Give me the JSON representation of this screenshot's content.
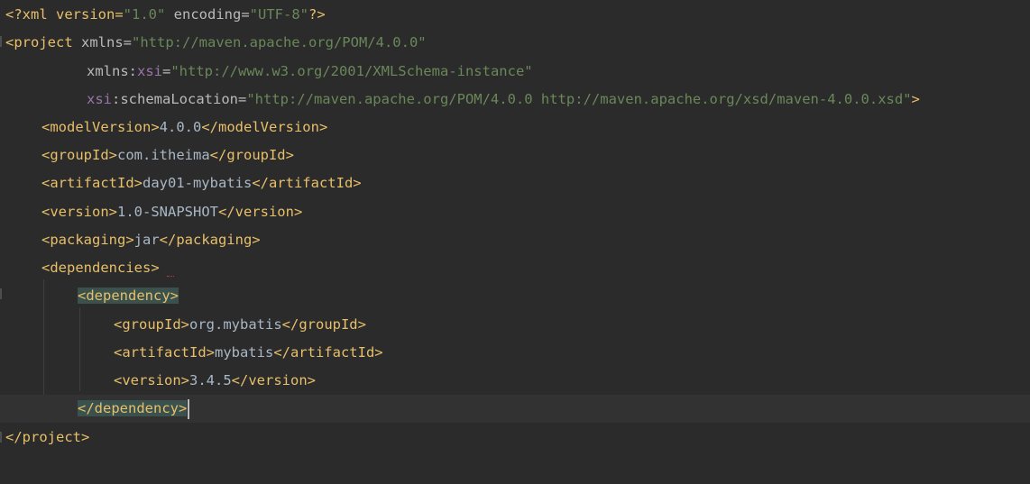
{
  "lines": [
    {
      "prolog": "<?xml version=",
      "v1": "\"1.0\"",
      "mid": " encoding=",
      "v2": "\"UTF-8\"",
      "end": "?>"
    },
    {
      "open": "<project ",
      "a1": "xmlns=",
      "v1": "\"http://maven.apache.org/POM/4.0.0\""
    },
    {
      "a1": "xmlns:",
      "ns": "xsi",
      "eq": "=",
      "v1": "\"http://www.w3.org/2001/XMLSchema-instance\""
    },
    {
      "ns": "xsi",
      "a1": ":schemaLocation=",
      "v1": "\"http://maven.apache.org/POM/4.0.0 http://maven.apache.org/xsd/maven-4.0.0.xsd\"",
      "end": ">"
    },
    {
      "open": "<modelVersion>",
      "text": "4.0.0",
      "close": "</modelVersion>"
    },
    {
      "open": "<groupId>",
      "text": "com.itheima",
      "close": "</groupId>"
    },
    {
      "open": "<artifactId>",
      "text": "day01-mybatis",
      "close": "</artifactId>"
    },
    {
      "open": "<version>",
      "text": "1.0-SNAPSHOT",
      "close": "</version>"
    },
    {
      "open": "<packaging>",
      "text": "jar",
      "close": "</packaging>"
    },
    {
      "open": "<dependencies>"
    },
    {
      "open": "<dependency>"
    },
    {
      "open": "<groupId>",
      "text": "org.mybatis",
      "close": "</groupId>"
    },
    {
      "open": "<artifactId>",
      "text": "mybatis",
      "close": "</artifactId>"
    },
    {
      "open": "<version>",
      "text": "3.4.5",
      "close": "</version>"
    },
    {
      "close": "</dependency>"
    },
    {
      "close": "</project>"
    }
  ],
  "colors": {
    "background": "#2b2b2b",
    "current_line": "#323232",
    "tag": "#e8bf6a",
    "attr_value": "#6a8759",
    "namespace": "#9876aa",
    "text": "#a9b7c6",
    "match_highlight": "#3b514d"
  }
}
